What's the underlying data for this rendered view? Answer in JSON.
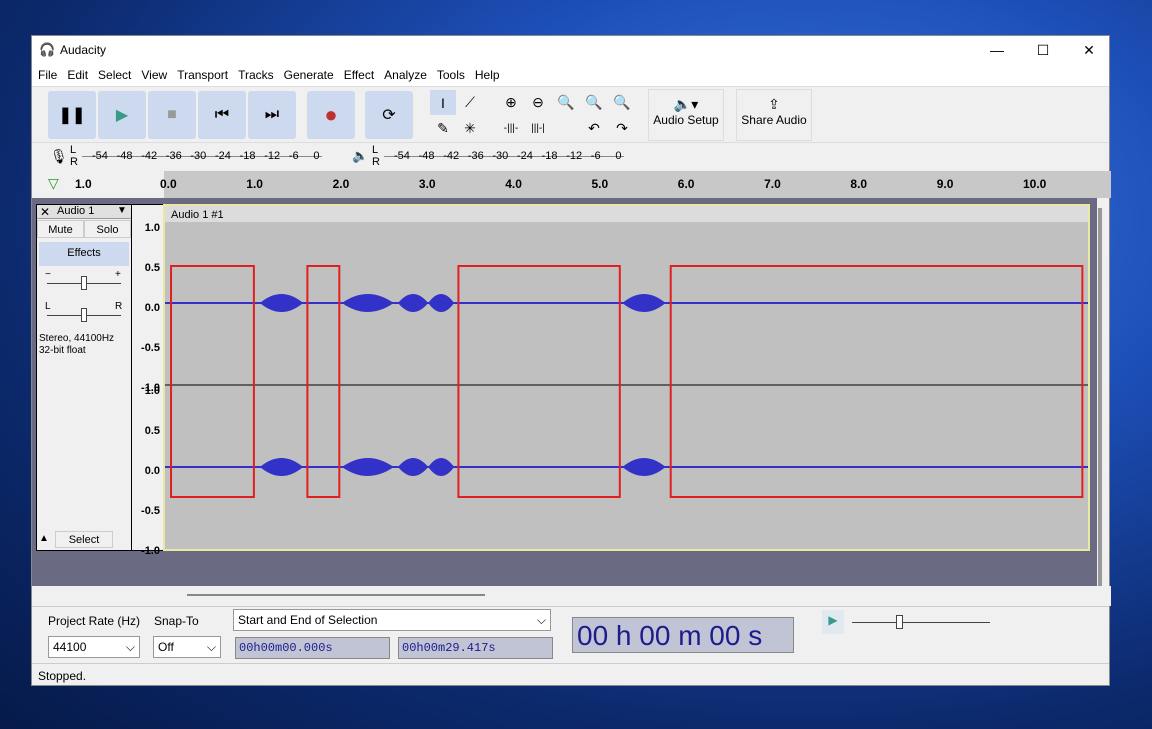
{
  "window": {
    "title": "Audacity",
    "minimize": "—",
    "maximize": "☐",
    "close": "✕"
  },
  "menu": [
    "File",
    "Edit",
    "Select",
    "View",
    "Transport",
    "Tracks",
    "Generate",
    "Effect",
    "Analyze",
    "Tools",
    "Help"
  ],
  "toolbar": {
    "audio_setup": "Audio Setup",
    "share_audio": "Share Audio"
  },
  "meters": {
    "record_scale": [
      "-54",
      "-48",
      "-42",
      "-36",
      "-30",
      "-24",
      "-18",
      "-12",
      "-6",
      "0"
    ],
    "play_scale": [
      "-54",
      "-48",
      "-42",
      "-36",
      "-30",
      "-24",
      "-18",
      "-12",
      "-6",
      "0"
    ],
    "L": "L",
    "R": "R"
  },
  "ruler": {
    "left_label": "1.0",
    "ticks": [
      "0.0",
      "1.0",
      "2.0",
      "3.0",
      "4.0",
      "5.0",
      "6.0",
      "7.0",
      "8.0",
      "9.0",
      "10.0"
    ]
  },
  "track": {
    "name": "Audio 1",
    "clip_name": "Audio 1 #1",
    "mute": "Mute",
    "solo": "Solo",
    "effects": "Effects",
    "info1": "Stereo, 44100Hz",
    "info2": "32-bit float",
    "select": "Select",
    "gain_minus": "−",
    "gain_plus": "+",
    "pan_l": "L",
    "pan_r": "R",
    "scale": [
      "1.0",
      "0.5",
      "0.0",
      "-0.5",
      "-1.0"
    ],
    "color": "#3232c8",
    "segments_sec": [
      [
        1.1,
        1.6
      ],
      [
        2.05,
        2.65
      ],
      [
        2.7,
        3.05
      ],
      [
        3.05,
        3.35
      ],
      [
        5.3,
        5.8
      ]
    ],
    "highlight_boxes_sec": [
      [
        0.07,
        1.03
      ],
      [
        1.65,
        2.02
      ],
      [
        3.4,
        5.27
      ],
      [
        5.86,
        10.63
      ]
    ],
    "highlight_color": "#e02020"
  },
  "bottom": {
    "project_rate_label": "Project Rate (Hz)",
    "project_rate": "44100",
    "snap_label": "Snap-To",
    "snap": "Off",
    "selection_mode": "Start and End of Selection",
    "sel_start": "00h00m00.000s",
    "sel_end": "00h00m29.417s",
    "position": "00 h 00 m 00 s"
  },
  "status": "Stopped."
}
